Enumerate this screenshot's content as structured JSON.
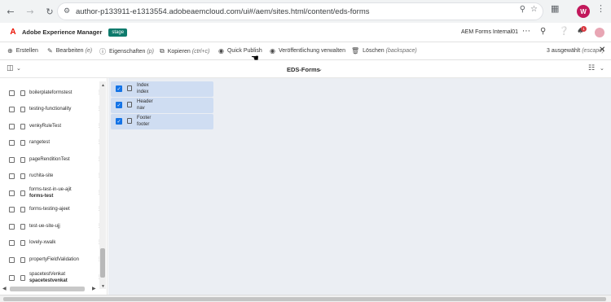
{
  "browser": {
    "url": "author-p133911-e1313554.adobeaemcloud.com/ui#/aem/sites.html/content/eds-forms",
    "profile_initial": "W"
  },
  "header": {
    "app_name": "Adobe Experience Manager",
    "env_badge": "stage",
    "org_name": "AEM Forms Internal01",
    "notification_count": "1"
  },
  "actions": [
    {
      "label": "Erstellen",
      "shortcut": "",
      "icon": "plus-icon"
    },
    {
      "label": "Bearbeiten",
      "shortcut": "(e)",
      "icon": "edit-icon"
    },
    {
      "label": "Eigenschaften",
      "shortcut": "(p)",
      "icon": "info-icon"
    },
    {
      "label": "Kopieren",
      "shortcut": "(ctrl+c)",
      "icon": "copy-icon"
    },
    {
      "label": "Quick Publish",
      "shortcut": "",
      "icon": "globe-icon"
    },
    {
      "label": "Veröffentlichung verwalten",
      "shortcut": "",
      "icon": "manage-publication-icon"
    },
    {
      "label": "Löschen",
      "shortcut": "(backspace)",
      "icon": "delete-icon"
    }
  ],
  "selection": {
    "count_text": "3 ausgewählt",
    "shortcut": "(escape)"
  },
  "view": {
    "title": "EDS-Forms"
  },
  "column1": [
    {
      "title": "boilerplateformstest",
      "subtitle": ""
    },
    {
      "title": "testing-functionality",
      "subtitle": ""
    },
    {
      "title": "venkyRuleTest",
      "subtitle": ""
    },
    {
      "title": "rangetest",
      "subtitle": ""
    },
    {
      "title": "pageRenditionTest",
      "subtitle": ""
    },
    {
      "title": "ruchita-site",
      "subtitle": ""
    },
    {
      "title": "forms-test-in-ue-ajit",
      "subtitle": "forms-test"
    },
    {
      "title": "forms-testing-ajeet",
      "subtitle": ""
    },
    {
      "title": "test-ue-site-ujj",
      "subtitle": ""
    },
    {
      "title": "lovely-xwalk",
      "subtitle": ""
    },
    {
      "title": "propertyFieldValidation",
      "subtitle": ""
    },
    {
      "title": "spacetestVenkat",
      "subtitle": "spacetestvenkat"
    }
  ],
  "column2": [
    {
      "title": "Index",
      "subtitle": "index"
    },
    {
      "title": "Header",
      "subtitle": "nav"
    },
    {
      "title": "Footer",
      "subtitle": "footer"
    }
  ],
  "colors": {
    "accent": "#1473e6",
    "selected_row": "#cfddf2",
    "env_badge": "#0e7a6c",
    "adobe_red": "#eb1000"
  }
}
